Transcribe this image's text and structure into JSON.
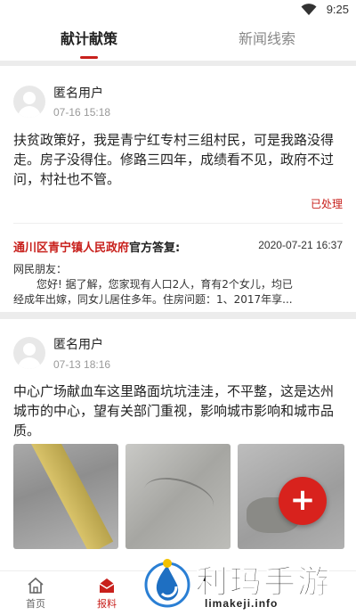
{
  "status_bar": {
    "time": "9:25",
    "wifi_icon": "wifi-icon"
  },
  "tabs": [
    {
      "label": "献计献策",
      "active": true
    },
    {
      "label": "新闻线索",
      "active": false
    }
  ],
  "posts": [
    {
      "user": "匿名用户",
      "time": "07-16  15:18",
      "text": "扶贫政策好，我是青宁红专村三组村民，可是我路没得走。房子没得住。修路三四年，成绩看不见，政府不过问，村社也不管。",
      "status": "已处理",
      "reply": {
        "org": "通川区青宁镇人民政府",
        "kind": "官方答复:",
        "date": "2020-07-21 16:37",
        "line1": "网民朋友：",
        "line2": "您好! 据了解，您家现有人口2人，育有2个女儿，均已",
        "line3": "经成年出嫁，同女儿居住多年。住房问题：1、2017年享..."
      }
    },
    {
      "user": "匿名用户",
      "time": "07-13  18:16",
      "text": "中心广场献血车这里路面坑坑洼洼，不平整，这是达州城市的中心，望有关部门重视，影响城市影响和城市品质。",
      "photos": 3
    }
  ],
  "fab": {
    "label": "+",
    "icon": "plus-icon"
  },
  "bottom_nav": [
    {
      "label": "首页",
      "icon": "home-icon",
      "active": false
    },
    {
      "label": "报料",
      "icon": "report-icon",
      "active": true
    }
  ],
  "watermark": {
    "brand": "利玛手游",
    "domain": "limakeji.info"
  },
  "colors": {
    "accent": "#c8201c",
    "fab": "#d8221d",
    "separator": "#ececec"
  }
}
